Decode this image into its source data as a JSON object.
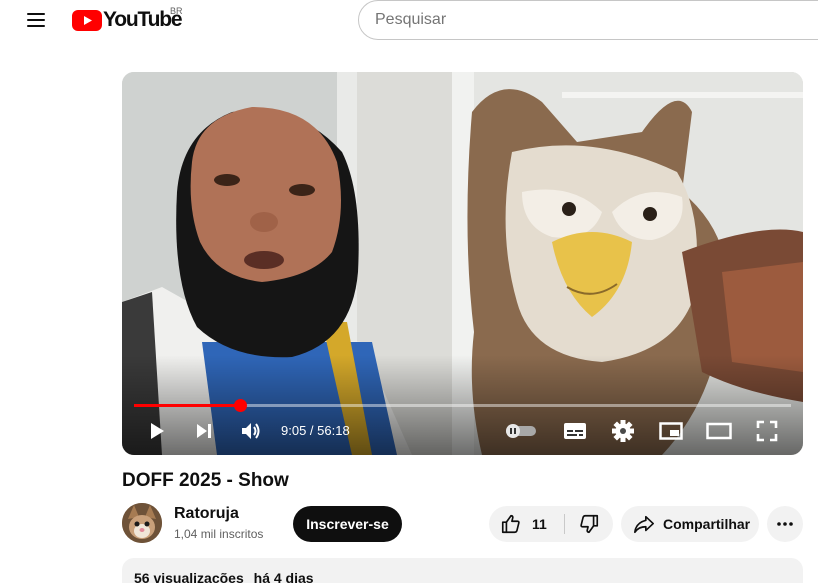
{
  "header": {
    "logo_text": "YouTube",
    "region_code": "BR",
    "search_placeholder": "Pesquisar"
  },
  "player": {
    "current_time": "9:05",
    "duration": "56:18",
    "time_display": "9:05 / 56:18",
    "progress_fraction": 0.161,
    "autoplay": "off"
  },
  "video": {
    "title": "DOFF 2025 - Show",
    "views": "56 visualizações",
    "age": "há 4 dias"
  },
  "channel": {
    "name": "Ratoruja",
    "subscribers": "1,04 mil inscritos",
    "subscribe_label": "Inscrever-se"
  },
  "actions": {
    "like_count": "11",
    "share_label": "Compartilhar"
  },
  "colors": {
    "brand_red": "#ff0000",
    "text_primary": "#0f0f0f",
    "text_secondary": "#606060",
    "chip_bg": "#f2f2f2"
  },
  "icons": [
    "menu-icon",
    "youtube-logo-icon",
    "play-icon",
    "next-icon",
    "volume-icon",
    "autoplay-toggle-icon",
    "subtitles-icon",
    "settings-icon",
    "miniplayer-icon",
    "theater-mode-icon",
    "fullscreen-icon",
    "like-icon",
    "dislike-icon",
    "share-icon",
    "more-icon"
  ]
}
